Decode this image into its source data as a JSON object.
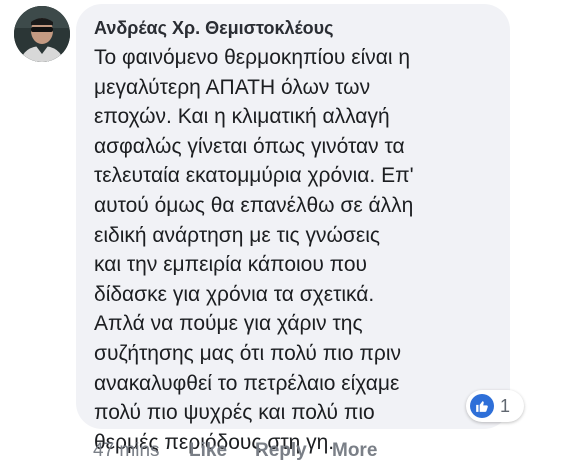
{
  "comment": {
    "author": "Ανδρέας Χρ. Θεμιστοκλέους",
    "lines": [
      "Το φαινόμενο θερμοκηπίου είναι η",
      "μεγαλύτερη ΑΠΑΤΗ όλων των",
      "εποχών. Και η κλιματική αλλαγή",
      "ασφαλώς γίνεται όπως γινόταν τα",
      "τελευταία εκατομμύρια χρόνια. Επ'",
      "αυτού όμως θα επανέλθω σε άλλη",
      "ειδική ανάρτηση με τις γνώσεις",
      "και την εμπειρία κάποιου που",
      "δίδασκε για χρόνια τα σχετικά.",
      "Απλά να πούμε για χάριν της",
      "συζήτησης μας ότι πολύ πιο πριν",
      "ανακαλυφθεί το πετρέλαιο είχαμε",
      "πολύ πιο ψυχρές και πολύ πιο",
      "θερμές περιόδους στη γη."
    ],
    "reactions": {
      "icon": "thumbs-up-icon",
      "count": "1",
      "color": "#2e6fd8"
    },
    "actions": {
      "timestamp": "47 mins",
      "like_label": "Like",
      "reply_label": "Reply",
      "more_label": "More"
    }
  }
}
